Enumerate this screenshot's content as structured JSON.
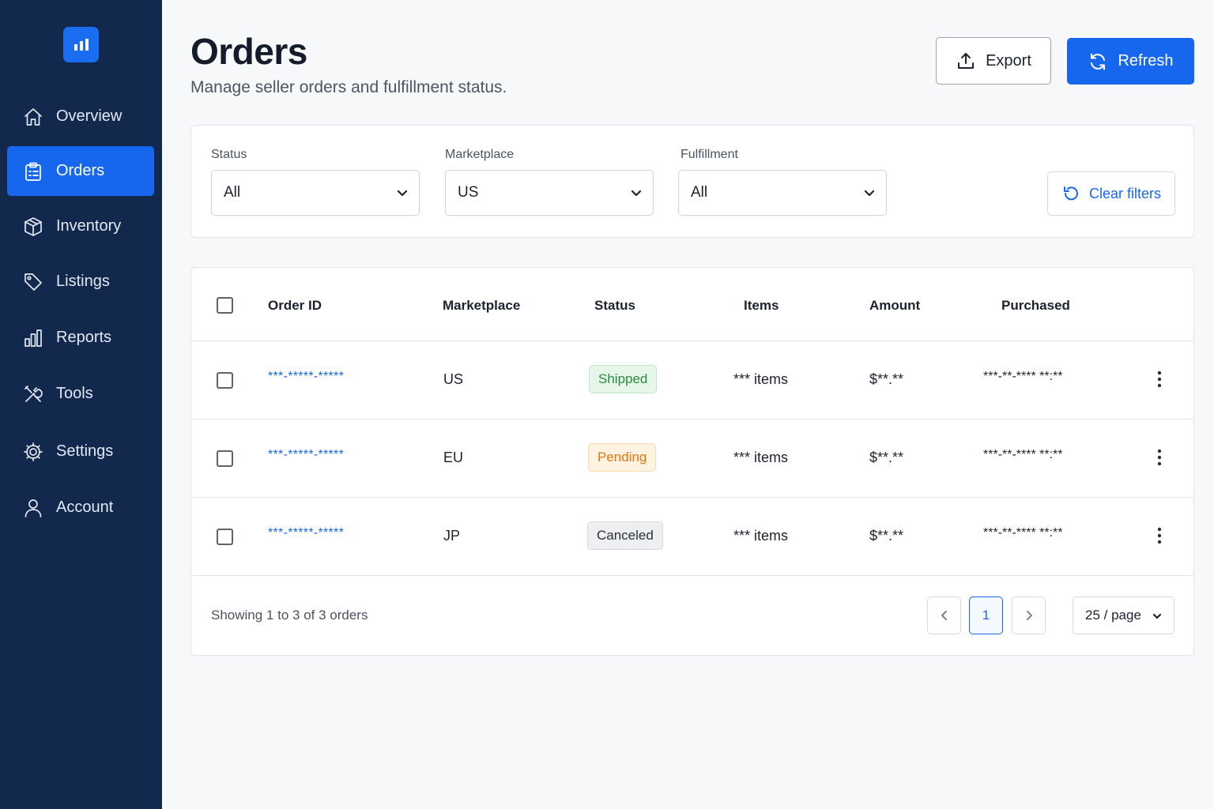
{
  "sidebar": {
    "logo_icon": "bar-chart-logo-icon",
    "items": [
      {
        "label": "Overview",
        "icon": "home-icon",
        "active": false
      },
      {
        "label": "Orders",
        "icon": "clipboard-icon",
        "active": true
      },
      {
        "label": "Inventory",
        "icon": "box-icon",
        "active": false
      },
      {
        "label": "Listings",
        "icon": "tag-icon",
        "active": false
      },
      {
        "label": "Reports",
        "icon": "bar-chart-icon",
        "active": false
      },
      {
        "label": "Tools",
        "icon": "tools-icon",
        "active": false
      },
      {
        "label": "Settings",
        "icon": "gear-icon",
        "active": false
      },
      {
        "label": "Account",
        "icon": "user-icon",
        "active": false
      }
    ]
  },
  "header": {
    "title": "Orders",
    "subtitle": "Manage seller orders and fulfillment status.",
    "export_label": "Export",
    "refresh_label": "Refresh"
  },
  "filters": {
    "status": {
      "label": "Status",
      "value": "All"
    },
    "marketplace": {
      "label": "Marketplace",
      "value": "US"
    },
    "fulfillment": {
      "label": "Fulfillment",
      "value": "All"
    },
    "clear_label": "Clear filters"
  },
  "table": {
    "columns": [
      "Order ID",
      "Marketplace",
      "Status",
      "Items",
      "Amount",
      "Purchased"
    ],
    "rows": [
      {
        "order_id": "***-*****-*****",
        "marketplace": "US",
        "status": "Shipped",
        "items": "*** items",
        "amount": "$**.**",
        "purchased": "***-**-**** **:**"
      },
      {
        "order_id": "***-*****-*****",
        "marketplace": "EU",
        "status": "Pending",
        "items": "*** items",
        "amount": "$**.**",
        "purchased": "***-**-**** **:**"
      },
      {
        "order_id": "***-*****-*****",
        "marketplace": "JP",
        "status": "Canceled",
        "items": "*** items",
        "amount": "$**.**",
        "purchased": "***-**-**** **:**"
      }
    ]
  },
  "pagination": {
    "summary": "Showing 1 to 3 of 3 orders",
    "current_page": "1",
    "per_page": "25 / page"
  },
  "colors": {
    "sidebar": "#13284d",
    "accent": "#1766ee",
    "shipped": "#2a8a3e",
    "pending": "#e0770f",
    "canceled": "#2a303a"
  }
}
